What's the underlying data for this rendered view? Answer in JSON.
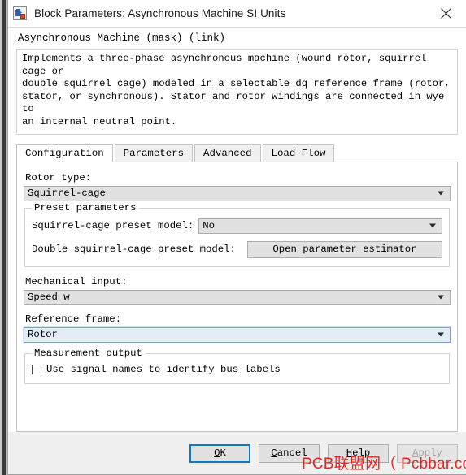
{
  "window": {
    "title": "Block Parameters: Asynchronous Machine SI Units",
    "icon": "simulink-block-icon",
    "close_label": "✕"
  },
  "mask": {
    "header": "Asynchronous Machine (mask) (link)",
    "description": "Implements a three-phase asynchronous machine (wound rotor, squirrel cage or\ndouble squirrel cage) modeled in a selectable dq reference frame (rotor,\nstator, or synchronous). Stator and rotor windings are connected in wye to\nan internal neutral point."
  },
  "tabs": [
    {
      "label": "Configuration",
      "active": true
    },
    {
      "label": "Parameters",
      "active": false
    },
    {
      "label": "Advanced",
      "active": false
    },
    {
      "label": "Load Flow",
      "active": false
    }
  ],
  "configuration": {
    "rotor_type": {
      "label": "Rotor type:",
      "value": "Squirrel-cage"
    },
    "preset_group": {
      "title": "Preset parameters",
      "squirrel_cage_preset": {
        "label": "Squirrel-cage preset model:",
        "value": "No"
      },
      "double_squirrel_cage_preset": {
        "label": "Double squirrel-cage preset model:",
        "button_label": "Open parameter estimator"
      }
    },
    "mechanical_input": {
      "label": "Mechanical input:",
      "value": "Speed w"
    },
    "reference_frame": {
      "label": "Reference frame:",
      "value": "Rotor",
      "focused": true
    },
    "measurement_group": {
      "title": "Measurement output",
      "checkbox": {
        "label": "Use signal names to identify bus labels",
        "checked": false
      }
    }
  },
  "footer": {
    "buttons": [
      {
        "name": "ok",
        "pre": "",
        "accel": "O",
        "post": "K",
        "default": true,
        "disabled": false
      },
      {
        "name": "cancel",
        "pre": "",
        "accel": "C",
        "post": "ancel",
        "default": false,
        "disabled": false
      },
      {
        "name": "help",
        "pre": "",
        "accel": "H",
        "post": "elp",
        "default": false,
        "disabled": false
      },
      {
        "name": "apply",
        "pre": "",
        "accel": "A",
        "post": "pply",
        "default": false,
        "disabled": true
      }
    ]
  },
  "watermark": {
    "text": "PCB联盟网（ Pcbbar.com ）",
    "color": "#e8251f"
  }
}
